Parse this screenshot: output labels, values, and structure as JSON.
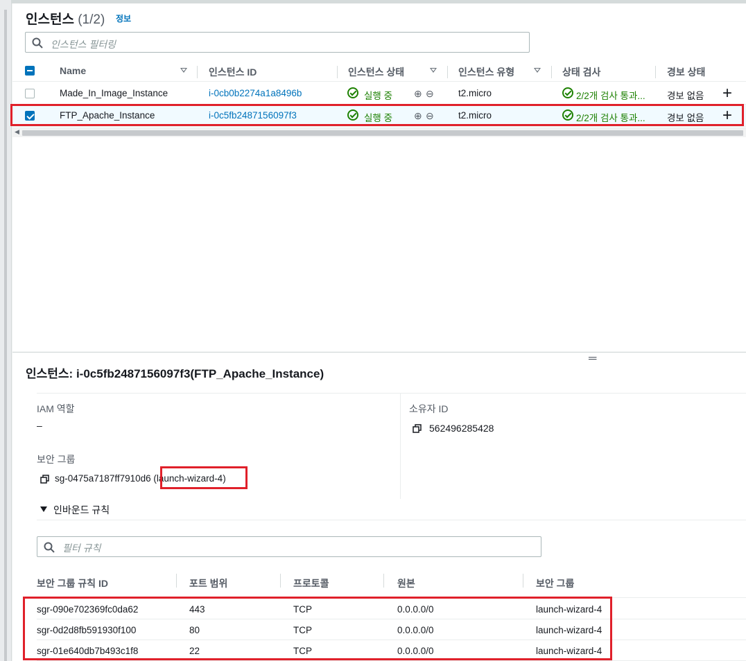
{
  "instances": {
    "title": "인스턴스",
    "count": "(1/2)",
    "info_link": "정보",
    "filter_placeholder": "인스턴스 필터링",
    "columns": [
      "Name",
      "인스턴스 ID",
      "인스턴스 상태",
      "인스턴스 유형",
      "상태 검사",
      "경보 상태"
    ],
    "rows": [
      {
        "name": "Made_In_Image_Instance",
        "id": "i-0cb0b2274a1a8496b",
        "state": "실행 중",
        "type": "t2.micro",
        "check": "2/2개 검사 통과...",
        "alarm": "경보 없음",
        "selected": false
      },
      {
        "name": "FTP_Apache_Instance",
        "id": "i-0c5fb2487156097f3",
        "state": "실행 중",
        "type": "t2.micro",
        "check": "2/2개 검사 통과...",
        "alarm": "경보 없음",
        "selected": true
      }
    ]
  },
  "detail": {
    "title": "인스턴스: i-0c5fb2487156097f3(FTP_Apache_Instance)",
    "iam_label": "IAM 역할",
    "iam_value": "–",
    "owner_label": "소유자 ID",
    "owner_value": "562496285428",
    "sg_label": "보안 그룹",
    "sg_id": "sg-0475a7187ff7910d6",
    "sg_name": "(launch-wizard-4)",
    "inbound_label": "인바운드 규칙",
    "rules_filter_placeholder": "필터 규칙",
    "rule_columns": [
      "보안 그룹 규칙 ID",
      "포트 범위",
      "프로토콜",
      "원본",
      "보안 그룹"
    ],
    "rules": [
      {
        "id": "sgr-090e702369fc0da62",
        "port": "443",
        "protocol": "TCP",
        "source": "0.0.0.0/0",
        "group": "launch-wizard-4"
      },
      {
        "id": "sgr-0d2d8fb591930f100",
        "port": "80",
        "protocol": "TCP",
        "source": "0.0.0.0/0",
        "group": "launch-wizard-4"
      },
      {
        "id": "sgr-01e640db7b493c1f8",
        "port": "22",
        "protocol": "TCP",
        "source": "0.0.0.0/0",
        "group": "launch-wizard-4"
      }
    ]
  },
  "colors": {
    "link": "#0073bb",
    "success": "#1d8102",
    "highlight": "#e0202a"
  }
}
